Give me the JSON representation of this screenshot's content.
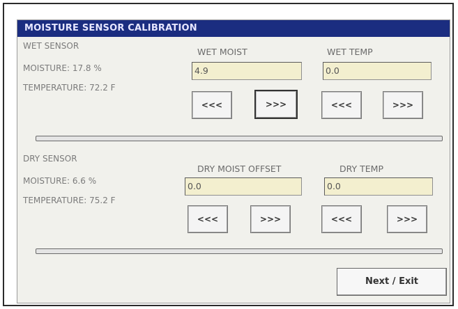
{
  "title": "MOISTURE SENSOR CALIBRATION",
  "wet": {
    "heading": "WET SENSOR",
    "moisture": "MOISTURE:   17.8 %",
    "temperature": "TEMPERATURE: 72.2 F",
    "moist_label": "WET MOIST",
    "moist_value": "4.9",
    "temp_label": "WET TEMP",
    "temp_value": "0.0"
  },
  "dry": {
    "heading": "DRY SENSOR",
    "moisture": "MOISTURE:    6.6 %",
    "temperature": "TEMPERATURE: 75.2 F",
    "moist_label": "DRY MOIST OFFSET",
    "moist_value": "0.0",
    "temp_label": "DRY TEMP",
    "temp_value": "0.0"
  },
  "buttons": {
    "decrease": "<<<",
    "increase": ">>>",
    "next_exit": "Next / Exit"
  },
  "colors": {
    "title_bar": "#1b2d80",
    "field_bg": "#f3efcf"
  }
}
